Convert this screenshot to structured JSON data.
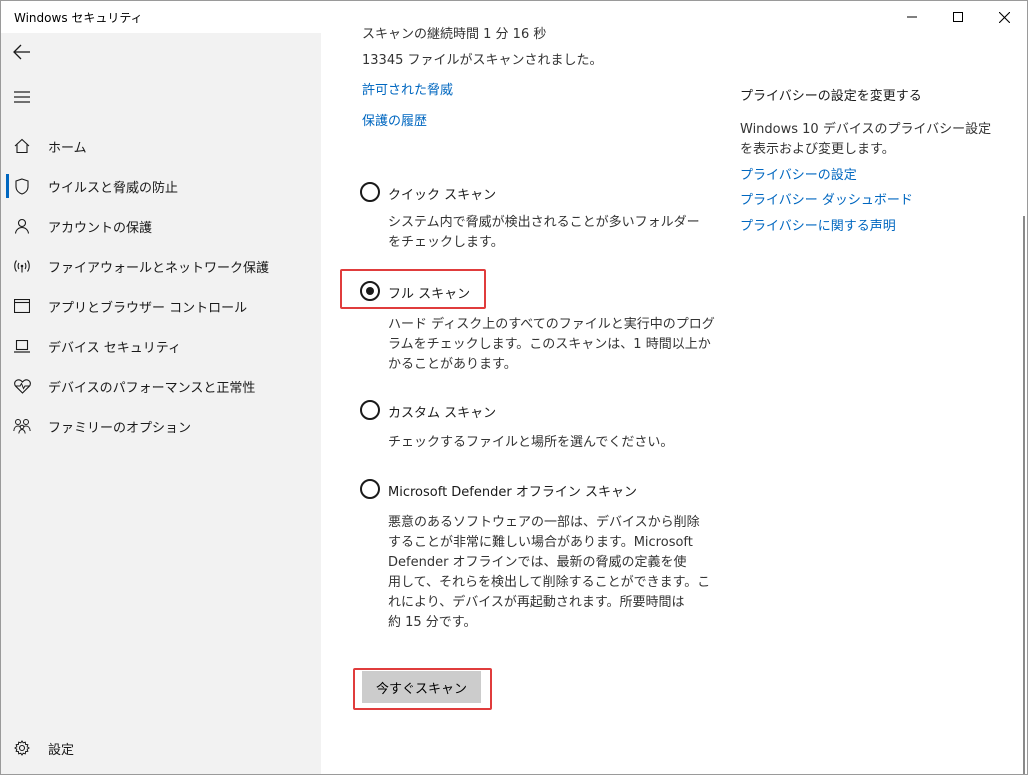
{
  "window": {
    "title": "Windows セキュリティ"
  },
  "sidebar": {
    "items": [
      {
        "label": "ホーム",
        "icon": "home-icon"
      },
      {
        "label": "ウイルスと脅威の防止",
        "icon": "shield-icon",
        "active": true
      },
      {
        "label": "アカウントの保護",
        "icon": "person-icon"
      },
      {
        "label": "ファイアウォールとネットワーク保護",
        "icon": "wireless-icon"
      },
      {
        "label": "アプリとブラウザー コントロール",
        "icon": "app-window-icon"
      },
      {
        "label": "デバイス セキュリティ",
        "icon": "laptop-icon"
      },
      {
        "label": "デバイスのパフォーマンスと正常性",
        "icon": "heart-pulse-icon"
      },
      {
        "label": "ファミリーのオプション",
        "icon": "family-icon"
      }
    ],
    "settings_label": "設定"
  },
  "main": {
    "scan_duration": "スキャンの継続時間 1 分 16 秒",
    "files_scanned": "13345 ファイルがスキャンされました。",
    "links": {
      "allowed_threats": "許可された脅威",
      "protection_history": "保護の履歴"
    },
    "options": [
      {
        "label": "クイック スキャン",
        "selected": false,
        "desc": [
          "システム内で脅威が検出されることが多いフォルダー",
          "をチェックします。"
        ]
      },
      {
        "label": "フル スキャン",
        "selected": true,
        "desc": [
          "ハード ディスク上のすべてのファイルと実行中のプログ",
          "ラムをチェックします。このスキャンは、1 時間以上か",
          "かることがあります。"
        ]
      },
      {
        "label": "カスタム スキャン",
        "selected": false,
        "desc": [
          "チェックするファイルと場所を選んでください。"
        ]
      },
      {
        "label": "Microsoft Defender オフライン スキャン",
        "selected": false,
        "desc": [
          "悪意のあるソフトウェアの一部は、デバイスから削除",
          "することが非常に難しい場合があります。Microsoft",
          "Defender オフラインでは、最新の脅威の定義を使",
          "用して、それらを検出して削除することができます。こ",
          "れにより、デバイスが再起動されます。所要時間は",
          "約 15 分です。"
        ]
      }
    ],
    "scan_button": "今すぐスキャン"
  },
  "privacy": {
    "title": "プライバシーの設定を変更する",
    "desc": [
      "Windows 10 デバイスのプライバシー設定",
      "を表示および変更します。"
    ],
    "links": [
      "プライバシーの設定",
      "プライバシー ダッシュボード",
      "プライバシーに関する声明"
    ]
  },
  "colors": {
    "accent": "#0067c0",
    "highlight": "#e03c3c",
    "sidebar_bg": "#f2f2f2",
    "button_bg": "#cccccc"
  }
}
